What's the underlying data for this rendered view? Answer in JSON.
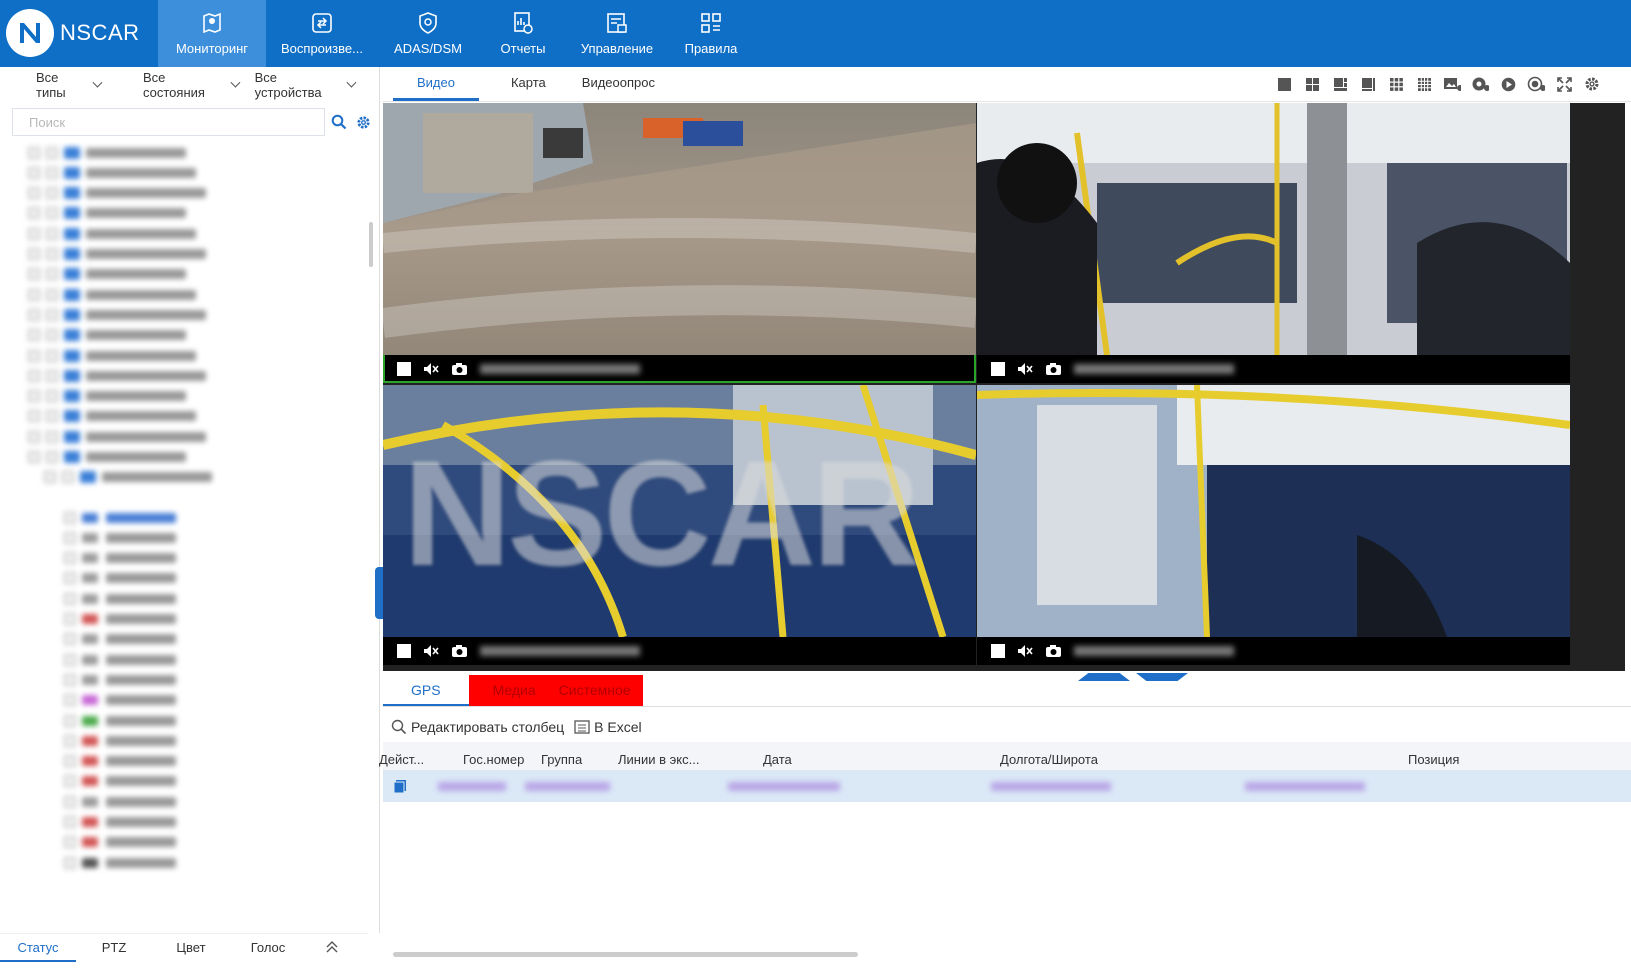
{
  "app": {
    "logo_text": "NSCAR"
  },
  "nav": [
    {
      "label": "Мониторинг",
      "icon": "map-pin-icon",
      "active": true
    },
    {
      "label": "Воспроизве...",
      "icon": "playback-icon",
      "active": false
    },
    {
      "label": "ADAS/DSM",
      "icon": "shield-icon",
      "active": false
    },
    {
      "label": "Отчеты",
      "icon": "report-icon",
      "active": false
    },
    {
      "label": "Управление",
      "icon": "management-icon",
      "active": false
    },
    {
      "label": "Правила",
      "icon": "rules-icon",
      "active": false
    }
  ],
  "filters": {
    "types": "Все типы",
    "states": "Все состояния",
    "devices": "Все устройства"
  },
  "search": {
    "placeholder": "Поиск"
  },
  "bottom_tabs": {
    "status": "Статус",
    "ptz": "PTZ",
    "color": "Цвет",
    "voice": "Голос"
  },
  "subtabs": {
    "video": "Видео",
    "map": "Карта",
    "video_poll": "Видеоопрос"
  },
  "watermark": "NSCAR",
  "panel_tabs": {
    "gps": "GPS",
    "media": "Медиа",
    "system": "Системное"
  },
  "toolbar": {
    "edit_columns": "Редактировать столбец",
    "excel": "В Excel"
  },
  "table": {
    "columns": [
      "Дейст...",
      "Гос.номер",
      "Группа",
      "Линии в экс...",
      "Дата",
      "Долгота/Широта",
      "Позиция"
    ]
  },
  "colors": {
    "brand": "#0f6fc6",
    "active_nav": "#3d8fdb",
    "accent": "#1f6fc8",
    "alert_tab": "#ff0000",
    "selected_border": "#2aa52a"
  }
}
